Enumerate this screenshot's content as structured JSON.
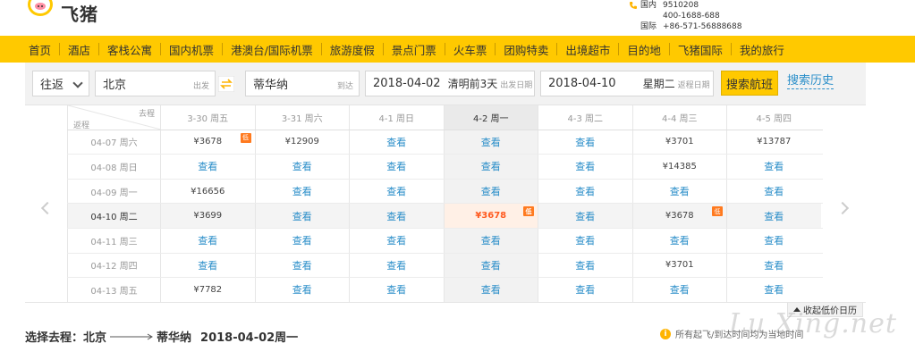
{
  "brand": {
    "name": "飞猪"
  },
  "contact": {
    "domestic_label": "国内",
    "domestic_1": "9510208",
    "domestic_2": "400-1688-688",
    "intl_label": "国际",
    "intl": "+86-571-56888688"
  },
  "nav": [
    "首页",
    "酒店",
    "客栈公寓",
    "国内机票",
    "港澳台/国际机票",
    "旅游度假",
    "景点门票",
    "火车票",
    "团购特卖",
    "出境超市",
    "目的地",
    "飞猪国际",
    "我的旅行"
  ],
  "search": {
    "trip_type": "往返",
    "from_city": "北京",
    "from_label": "出发",
    "to_city": "蒂华纳",
    "to_label": "到达",
    "depart_date": "2018-04-02",
    "depart_note": "清明前3天",
    "depart_label": "出发日期",
    "return_date": "2018-04-10",
    "return_note": "星期二",
    "return_label": "返程日期",
    "search_button": "搜索航班",
    "history": "搜索历史"
  },
  "calendar": {
    "corner_go": "去程",
    "corner_back": "返程",
    "columns": [
      "3-30 周五",
      "3-31 周六",
      "4-1 周日",
      "4-2 周一",
      "4-3 周二",
      "4-4 周三",
      "4-5 周四"
    ],
    "rows": [
      {
        "date": "04-07 周六",
        "cells": [
          "¥3678",
          "¥12909",
          "查看",
          "查看",
          "查看",
          "¥3701",
          "¥13787"
        ]
      },
      {
        "date": "04-08 周日",
        "cells": [
          "查看",
          "查看",
          "查看",
          "查看",
          "查看",
          "¥14385",
          "查看"
        ]
      },
      {
        "date": "04-09 周一",
        "cells": [
          "¥16656",
          "查看",
          "查看",
          "查看",
          "查看",
          "查看",
          "查看"
        ]
      },
      {
        "date": "04-10 周二",
        "cells": [
          "¥3699",
          "查看",
          "查看",
          "¥3678",
          "查看",
          "¥3678",
          "查看"
        ]
      },
      {
        "date": "04-11 周三",
        "cells": [
          "查看",
          "查看",
          "查看",
          "查看",
          "查看",
          "查看",
          "查看"
        ]
      },
      {
        "date": "04-12 周四",
        "cells": [
          "查看",
          "查看",
          "查看",
          "查看",
          "查看",
          "¥3701",
          "查看"
        ]
      },
      {
        "date": "04-13 周五",
        "cells": [
          "¥7782",
          "查看",
          "查看",
          "查看",
          "查看",
          "查看",
          "查看"
        ]
      }
    ],
    "low_badge": "低",
    "collapse_label": "收起低价日历"
  },
  "selected_trip": {
    "label": "选择去程：北京",
    "to": "蒂华纳",
    "date": "2018-04-02周一"
  },
  "notice": "所有起飞/到达时间均为当地时间",
  "watermark": "Lu Xing.net",
  "colors": {
    "accent": "#ffc900",
    "link": "#2a8ec9",
    "low": "#ff7a1f"
  }
}
